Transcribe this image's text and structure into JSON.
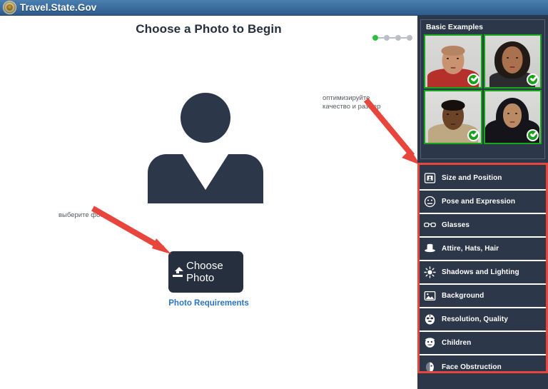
{
  "header": {
    "brand": "Travel.State.Gov",
    "seal_icon": "state-department-seal-icon"
  },
  "main": {
    "page_title": "Choose a Photo to Begin",
    "avatar_icon": "person-silhouette-icon",
    "choose_photo_button": {
      "label": "Choose Photo",
      "icon": "upload-icon"
    },
    "photo_requirements_link": "Photo Requirements",
    "stepper": {
      "steps": 4,
      "active_index": 0,
      "active_color": "#2fbf3f",
      "inactive_color": "#b9bfc6"
    }
  },
  "annotations": [
    {
      "name": "annotation-choose-photo",
      "text": "выберите фото",
      "arrow": "red-arrow-down-right"
    },
    {
      "name": "annotation-quality-size",
      "text": "оптимизируйте\nкачество и размер",
      "arrow": "red-arrow-down-right"
    }
  ],
  "right_panel": {
    "examples": {
      "title": "Basic Examples",
      "photos": [
        {
          "alt": "bald-man-red-shirt",
          "status": "approved",
          "badge_icon": "check-circle-icon"
        },
        {
          "alt": "woman-long-dark-hair",
          "status": "approved",
          "badge_icon": "check-circle-icon"
        },
        {
          "alt": "man-tan-jacket",
          "status": "approved",
          "badge_icon": "check-circle-icon"
        },
        {
          "alt": "woman-black-headscarf",
          "status": "approved",
          "badge_icon": "check-circle-icon"
        }
      ]
    },
    "accordion": {
      "highlight_color": "#e8453c",
      "items": [
        {
          "label": "Size and Position",
          "icon": "person-in-frame-icon"
        },
        {
          "label": "Pose and Expression",
          "icon": "neutral-face-icon"
        },
        {
          "label": "Glasses",
          "icon": "glasses-icon"
        },
        {
          "label": "Attire, Hats, Hair",
          "icon": "hat-icon"
        },
        {
          "label": "Shadows and Lighting",
          "icon": "sun-icon"
        },
        {
          "label": "Background",
          "icon": "image-icon"
        },
        {
          "label": "Resolution, Quality",
          "icon": "face-grid-icon"
        },
        {
          "label": "Children",
          "icon": "child-face-icon"
        },
        {
          "label": "Face Obstruction",
          "icon": "face-obstruction-icon"
        }
      ]
    }
  },
  "colors": {
    "header_blue": "#3d6e9e",
    "panel_navy": "#2c3749",
    "accent_red": "#e8453c",
    "link_blue": "#2a75c4",
    "check_green": "#1aa01d"
  }
}
